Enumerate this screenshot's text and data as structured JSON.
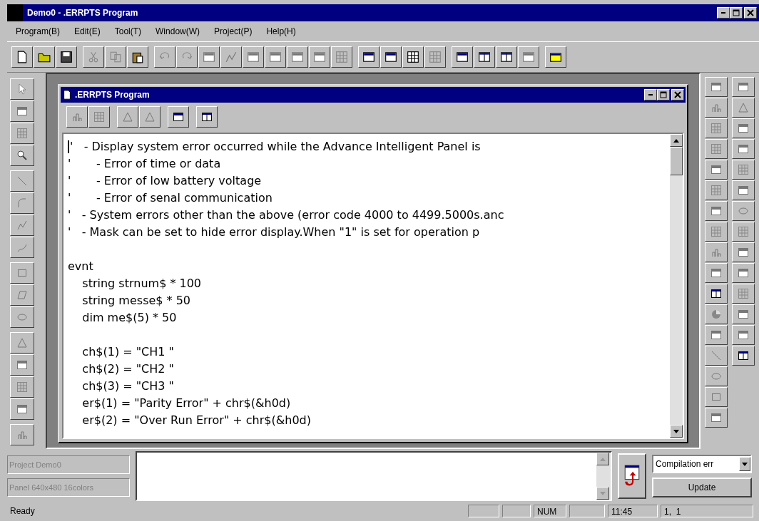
{
  "window": {
    "title": "Demo0 - .ERRPTS Program"
  },
  "menu": [
    "Program(B)",
    "Edit(E)",
    "Tool(T)",
    "Window(W)",
    "Project(P)",
    "Help(H)"
  ],
  "child_window": {
    "title": ".ERRPTS Program",
    "code_blocks": [
      [
        "'   - Display system error occurred while the Advance Intelligent Panel is",
        "'       - Error of time or data",
        "'       - Error of low battery voltage",
        "'       - Error of senal communication",
        "'   - System errors other than the above (error code 4000 to 4499.5000s.anc",
        "'   - Mask can be set to hide error display.When \"1\" is set for operation p"
      ],
      [
        "evnt",
        "    string strnum$ * 100",
        "    string messe$ * 50",
        "    dim me$(5) * 50"
      ],
      [
        "    ch$(1) = \"CH1 \"",
        "    ch$(2) = \"CH2 \"",
        "    ch$(3) = \"CH3 \"",
        "    er$(1) = \"Parity Error\" + chr$(&h0d)",
        "    er$(2) = \"Over Run Error\" + chr$(&h0d)"
      ]
    ]
  },
  "bottom_panel": {
    "project_label": "Project Demo0",
    "panel_label": "Panel 640x480 16colors",
    "output_filter": "Compilation err",
    "update_button": "Update"
  },
  "status_bar": {
    "message": "Ready",
    "num": "NUM",
    "time": "11:45",
    "position": "1,  1"
  }
}
